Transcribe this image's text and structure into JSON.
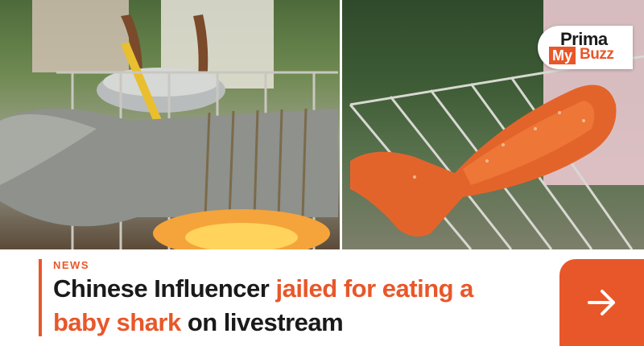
{
  "brand": {
    "logo_top": "Prima",
    "logo_my": "My",
    "logo_buzz": "Buzz"
  },
  "article": {
    "category": "NEWS",
    "headline_parts": [
      {
        "text": "Chinese Influencer ",
        "highlight": false
      },
      {
        "text": "jailed for eating a",
        "highlight": true
      },
      {
        "text": " ",
        "highlight": false
      },
      {
        "text": "baby shark",
        "highlight": true
      },
      {
        "text": " on livestream",
        "highlight": false
      }
    ]
  },
  "icons": {
    "read_more": "arrow-right-icon"
  },
  "colors": {
    "accent": "#e8572a",
    "headline": "#1a1a1a",
    "background": "#ffffff"
  }
}
